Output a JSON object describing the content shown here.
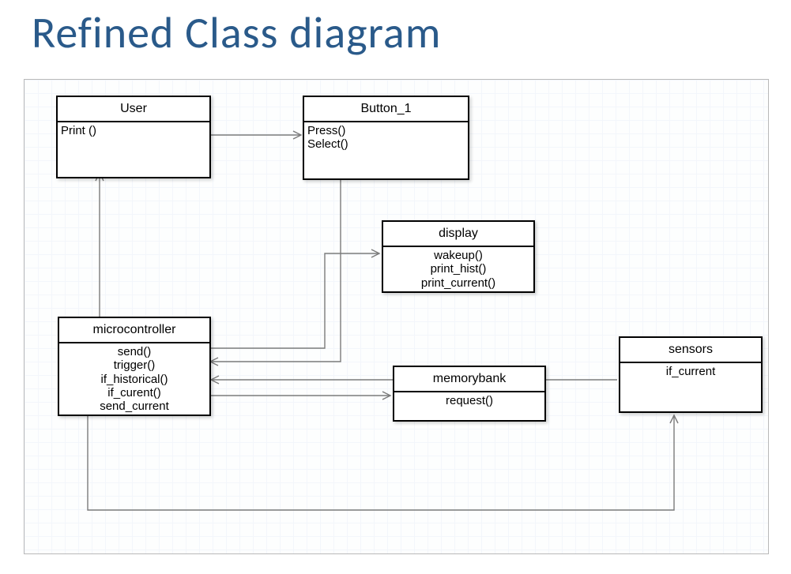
{
  "title": "Refined Class diagram",
  "classes": {
    "user": {
      "name": "User",
      "methods": [
        "Print ()"
      ]
    },
    "button1": {
      "name": "Button_1",
      "methods": [
        "Press()",
        "Select()"
      ]
    },
    "display": {
      "name": "display",
      "methods": [
        "wakeup()",
        "print_hist()",
        "print_current()"
      ]
    },
    "microcontroller": {
      "name": "microcontroller",
      "methods": [
        "send()",
        "trigger()",
        "if_historical()",
        "if_curent()",
        "send_current"
      ]
    },
    "memorybank": {
      "name": "memorybank",
      "methods": [
        "request()"
      ]
    },
    "sensors": {
      "name": "sensors",
      "methods": [
        "if_current"
      ]
    }
  },
  "relationships": [
    {
      "from": "user",
      "to": "button1",
      "arrow": "open"
    },
    {
      "from": "microcontroller",
      "to": "user",
      "arrow": "open"
    },
    {
      "from": "button1",
      "to": "microcontroller",
      "arrow": "open"
    },
    {
      "from": "microcontroller",
      "to": "display",
      "arrow": "open"
    },
    {
      "from": "microcontroller",
      "to": "memorybank",
      "arrow": "open"
    },
    {
      "from": "microcontroller",
      "to": "sensors",
      "arrow": "open"
    },
    {
      "from": "sensors",
      "to": "microcontroller",
      "arrow": "open"
    }
  ]
}
